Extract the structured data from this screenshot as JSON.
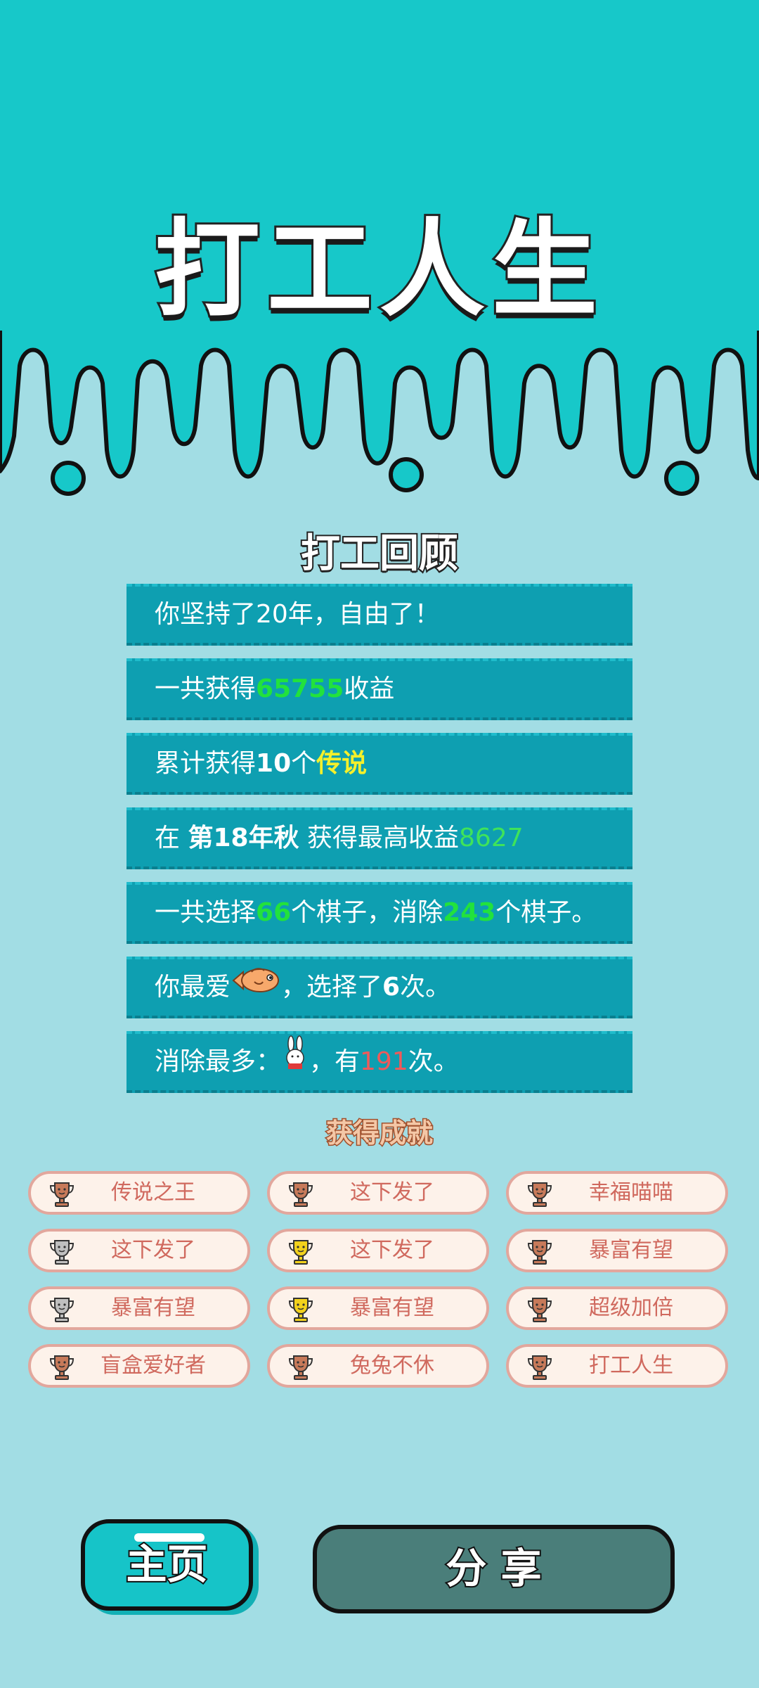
{
  "header": {
    "title": "打工人生"
  },
  "review": {
    "title": "打工回顾",
    "row1": {
      "text": "你坚持了20年，自由了！"
    },
    "row2": {
      "pre": "一共获得",
      "value": "65755",
      "post": "收益"
    },
    "row3": {
      "pre": "累计获得",
      "count": "10",
      "mid": "个",
      "rarity": "传说"
    },
    "row4": {
      "pre": "在 ",
      "season": "第18年秋",
      "mid": " 获得最高收益",
      "value": "8627"
    },
    "row5": {
      "pre": "一共选择",
      "chosen": "66",
      "mid": "个棋子，消除",
      "removed": "243",
      "post": "个棋子。"
    },
    "row6": {
      "pre": "你最爱",
      "icon": "fish-icon",
      "mid": "，选择了",
      "count": "6",
      "post": "次。"
    },
    "row7": {
      "pre": "消除最多：",
      "icon": "rabbit-icon",
      "mid": "，有",
      "count": "191",
      "post": "次。"
    }
  },
  "achievements": {
    "title": "获得成就",
    "items": [
      {
        "label": "传说之王",
        "tier": "bronze"
      },
      {
        "label": "这下发了",
        "tier": "bronze"
      },
      {
        "label": "幸福喵喵",
        "tier": "bronze"
      },
      {
        "label": "这下发了",
        "tier": "silver"
      },
      {
        "label": "这下发了",
        "tier": "gold"
      },
      {
        "label": "暴富有望",
        "tier": "bronze"
      },
      {
        "label": "暴富有望",
        "tier": "silver"
      },
      {
        "label": "暴富有望",
        "tier": "gold"
      },
      {
        "label": "超级加倍",
        "tier": "bronze"
      },
      {
        "label": "盲盒爱好者",
        "tier": "bronze"
      },
      {
        "label": "兔兔不休",
        "tier": "bronze"
      },
      {
        "label": "打工人生",
        "tier": "bronze"
      }
    ]
  },
  "buttons": {
    "home": "主页",
    "share": "分 享"
  },
  "colors": {
    "top_band": "#17c8c9",
    "background": "#a2dde4",
    "row_bg": "#0e9fb1",
    "green": "#22e23c",
    "red": "#ee5a5a",
    "yellow": "#f5f02a",
    "trophy_bronze": "#c77a5a",
    "trophy_silver": "#bfbfbf",
    "trophy_gold": "#f3d21c"
  }
}
